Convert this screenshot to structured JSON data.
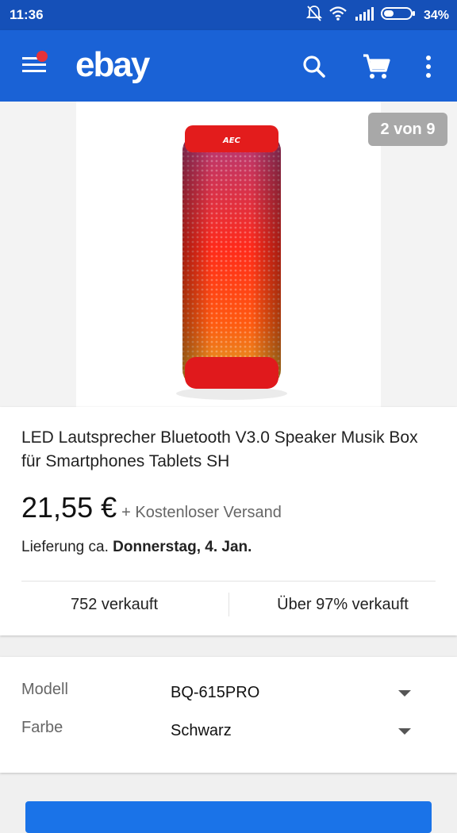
{
  "status": {
    "time": "11:36",
    "battery": "34%"
  },
  "appbar": {
    "logo": "ebay"
  },
  "gallery": {
    "counter": "2 von 9",
    "brand_mark": "AEC"
  },
  "product": {
    "title": "LED Lautsprecher Bluetooth V3.0 Speaker Musik Box für Smartphones Tablets SH",
    "price": "21,55 €",
    "shipping": "+ Kostenloser Versand",
    "delivery_prefix": "Lieferung ca. ",
    "delivery_date": "Donnerstag, 4. Jan.",
    "sold": "752 verkauft",
    "rating": "Über 97% verkauft"
  },
  "variants": {
    "model_label": "Modell",
    "model_value": "BQ-615PRO",
    "color_label": "Farbe",
    "color_value": "Schwarz"
  },
  "colors": {
    "accent": "#1a62d6",
    "statusbar": "#1550b8",
    "notification": "#e53238"
  }
}
